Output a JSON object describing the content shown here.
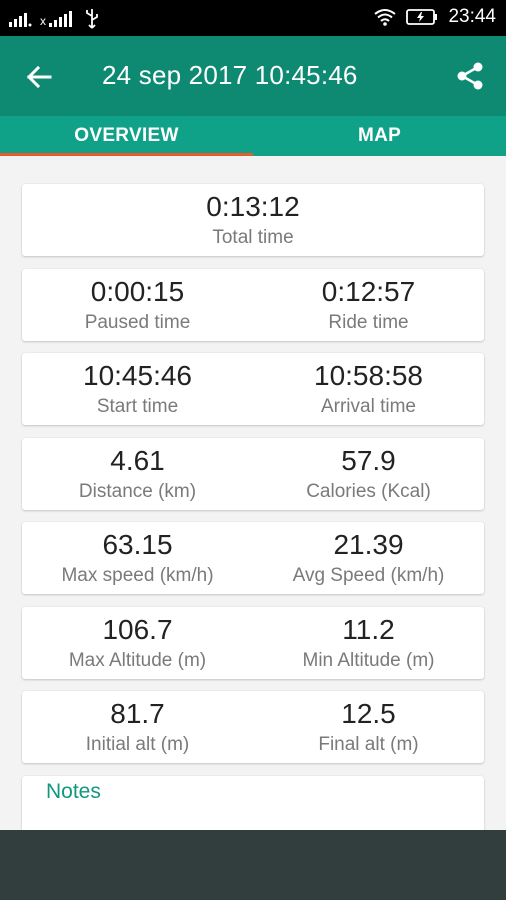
{
  "status_bar": {
    "time": "23:44",
    "icons": [
      "signal-icon",
      "signal-off-icon",
      "usb-icon",
      "wifi-icon",
      "battery-icon"
    ]
  },
  "header": {
    "title": "24 sep 2017 10:45:46",
    "back_icon": "arrow-back-icon",
    "share_icon": "share-icon"
  },
  "tabs": [
    {
      "label": "OVERVIEW",
      "selected": true
    },
    {
      "label": "MAP",
      "selected": false
    }
  ],
  "stats": {
    "total_time": {
      "value": "0:13:12",
      "label": "Total time"
    },
    "paused_time": {
      "value": "0:00:15",
      "label": "Paused time"
    },
    "ride_time": {
      "value": "0:12:57",
      "label": "Ride time"
    },
    "start_time": {
      "value": "10:45:46",
      "label": "Start time"
    },
    "arrival_time": {
      "value": "10:58:58",
      "label": "Arrival time"
    },
    "distance": {
      "value": "4.61",
      "label": "Distance (km)"
    },
    "calories": {
      "value": "57.9",
      "label": "Calories (Kcal)"
    },
    "max_speed": {
      "value": "63.15",
      "label": "Max speed (km/h)"
    },
    "avg_speed": {
      "value": "21.39",
      "label": "Avg Speed (km/h)"
    },
    "max_altitude": {
      "value": "106.7",
      "label": "Max Altitude (m)"
    },
    "min_altitude": {
      "value": "11.2",
      "label": "Min Altitude (m)"
    },
    "initial_alt": {
      "value": "81.7",
      "label": "Initial alt (m)"
    },
    "final_alt": {
      "value": "12.5",
      "label": "Final alt (m)"
    }
  },
  "notes": {
    "title": "Notes"
  },
  "colors": {
    "appbar": "#0e8a73",
    "tabs": "#10a289",
    "indicator": "#e65a2f",
    "notes_title": "#13977f"
  }
}
